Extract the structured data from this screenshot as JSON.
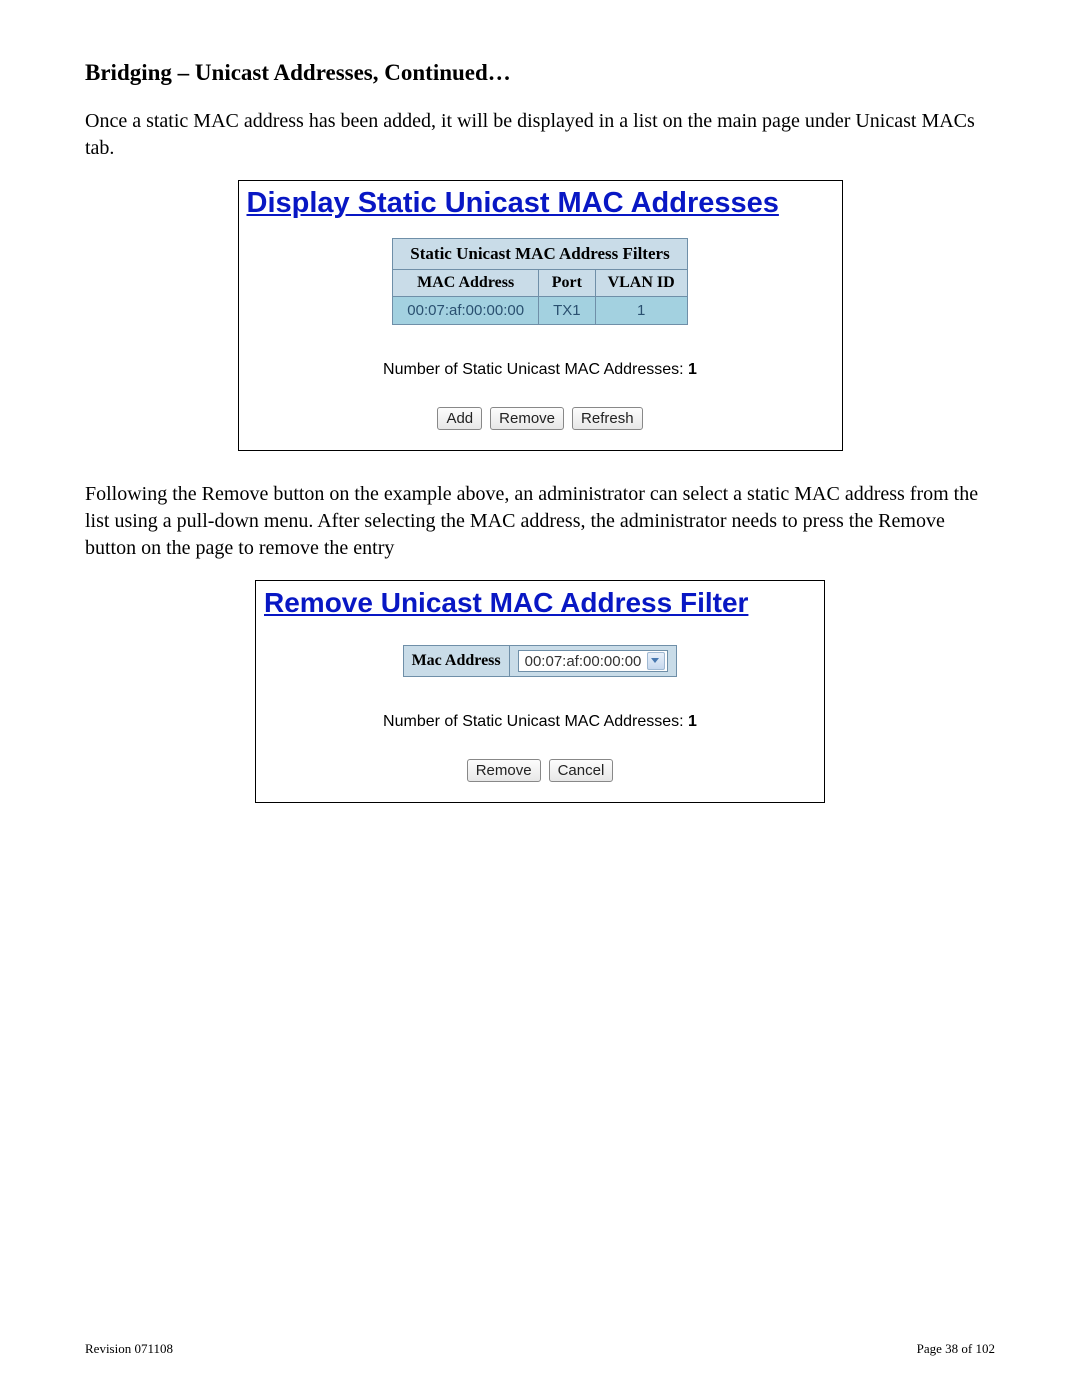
{
  "heading": "Bridging – Unicast Addresses, Continued…",
  "para1": "Once a static MAC address has been added, it will be displayed in a list on the main page under Unicast MACs tab.",
  "panel1": {
    "title": "Display Static Unicast MAC Addresses",
    "table_caption": "Static Unicast MAC Address Filters",
    "cols": {
      "c1": "MAC Address",
      "c2": "Port",
      "c3": "VLAN ID"
    },
    "row": {
      "mac": "00:07:af:00:00:00",
      "port": "TX1",
      "vlan": "1"
    },
    "count_label": "Number of Static Unicast MAC Addresses: ",
    "count_value": "1",
    "buttons": {
      "add": "Add",
      "remove": "Remove",
      "refresh": "Refresh"
    }
  },
  "para2": "Following the Remove button on the example above, an administrator can select a static MAC address from the list using a pull-down menu.  After selecting the MAC address, the administrator needs to press the Remove button on the page to remove the entry",
  "panel2": {
    "title": "Remove Unicast MAC Address Filter",
    "form_label": "Mac Address",
    "selected_mac": "00:07:af:00:00:00",
    "count_label": "Number of Static Unicast MAC Addresses: ",
    "count_value": "1",
    "buttons": {
      "remove": "Remove",
      "cancel": "Cancel"
    }
  },
  "footer": {
    "left": "Revision 071108",
    "right": "Page 38 of 102"
  }
}
